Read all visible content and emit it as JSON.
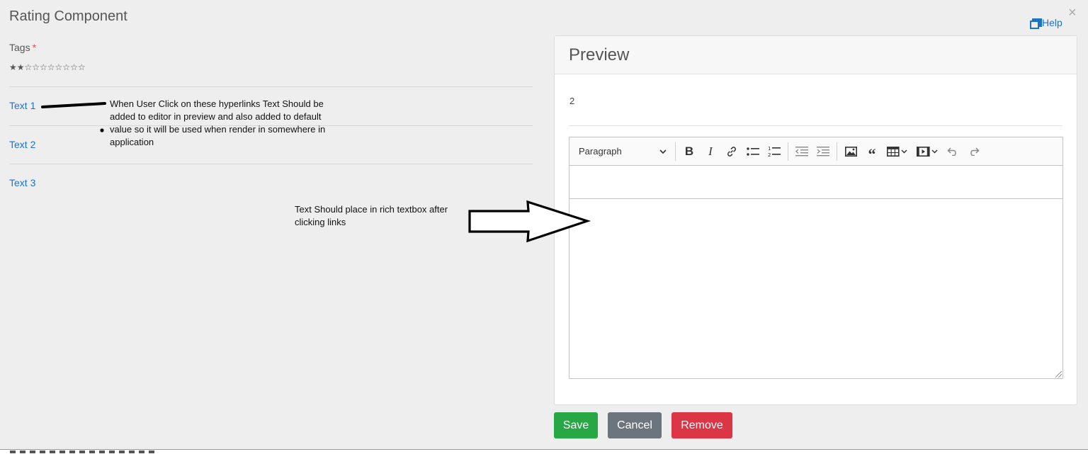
{
  "modal": {
    "title": "Rating Component",
    "close_glyph": "×",
    "help_label": "Help"
  },
  "form": {
    "tags_label": "Tags",
    "required_mark": "*",
    "stars_display": "★★☆☆☆☆☆☆☆☆",
    "stars_value": 2,
    "stars_max": 10,
    "links": [
      "Text 1",
      "Text 2",
      "Text 3"
    ]
  },
  "annotations": {
    "note_1": "When User Click on these hyperlinks Text Should be added to editor in preview and also added to default value so it will be used when render in somewhere in application",
    "note_1_lines": [
      "When User Click on these hyperlinks Text Should be",
      "added to editor in preview and also added to default",
      "value so it will be used when render in somewhere in",
      "application"
    ],
    "note_2_lines": [
      "Text Should place in rich textbox after",
      "clicking links"
    ]
  },
  "preview": {
    "title": "Preview",
    "value": "2",
    "editor": {
      "heading_select": "Paragraph",
      "toolbar_icons": [
        "bold-icon",
        "italic-icon",
        "link-icon",
        "bulleted-list-icon",
        "numbered-list-icon",
        "outdent-icon",
        "indent-icon",
        "image-icon",
        "quote-icon",
        "table-icon",
        "media-icon",
        "undo-icon",
        "redo-icon"
      ],
      "content": ""
    }
  },
  "buttons": {
    "save": "Save",
    "cancel": "Cancel",
    "remove": "Remove"
  },
  "colors": {
    "link": "#1a73c9",
    "save": "#28a745",
    "cancel": "#6c757d",
    "remove": "#dc3545",
    "required": "#d9534f"
  }
}
